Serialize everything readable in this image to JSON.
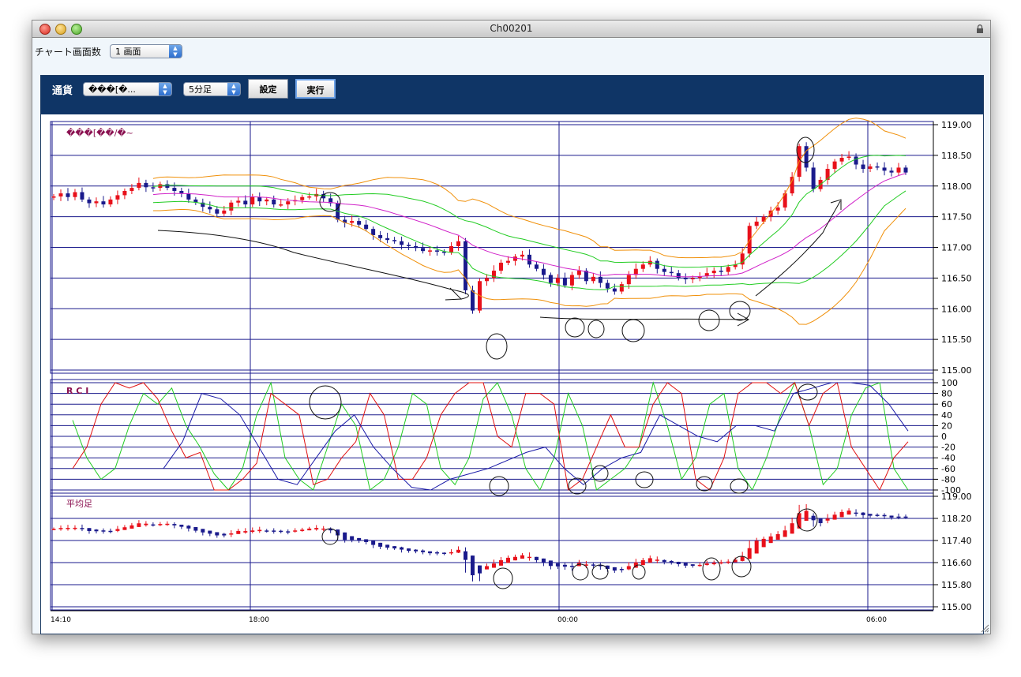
{
  "window": {
    "title": "Ch00201"
  },
  "topbar": {
    "screens_label": "チャート画面数",
    "screens_value": "1 画面"
  },
  "toolbar": {
    "currency_label": "通貨",
    "currency_value": "���[�...",
    "period_value": "5分足",
    "settings_label": "設定",
    "run_label": "実行"
  },
  "colors": {
    "up_candle": "#e8101a",
    "down_candle": "#1a1a8c",
    "grid": "#1a1a8c",
    "toolbar_bg": "#0f3566",
    "bb_outer": "#f0900a",
    "bb_inner": "#22cc22",
    "ma": "#d020c8",
    "rci_short": "#22cc22",
    "rci_mid": "#e01010",
    "rci_long": "#1a1aa8"
  },
  "chart_data": [
    {
      "type": "candlestick",
      "title": "���[��/�~",
      "y_ticks": [
        "119.00",
        "118.50",
        "118.00",
        "117.50",
        "117.00",
        "116.50",
        "116.00",
        "115.50",
        "115.00"
      ],
      "ylim": [
        115.0,
        119.0
      ],
      "overlays": [
        "bollinger-outer",
        "bollinger-inner",
        "moving-average"
      ],
      "close": [
        117.83,
        117.88,
        117.82,
        117.9,
        117.78,
        117.72,
        117.75,
        117.7,
        117.78,
        117.85,
        117.92,
        117.97,
        118.05,
        117.98,
        117.97,
        118.03,
        117.97,
        117.92,
        117.88,
        117.78,
        117.73,
        117.66,
        117.62,
        117.55,
        117.6,
        117.73,
        117.76,
        117.7,
        117.82,
        117.75,
        117.78,
        117.7,
        117.7,
        117.75,
        117.77,
        117.82,
        117.83,
        117.87,
        117.8,
        117.72,
        117.45,
        117.4,
        117.43,
        117.37,
        117.3,
        117.2,
        117.15,
        117.12,
        117.1,
        117.04,
        117.02,
        116.99,
        116.94,
        116.95,
        116.93,
        116.92,
        117.02,
        117.1,
        116.3,
        115.97,
        116.45,
        116.5,
        116.62,
        116.75,
        116.78,
        116.85,
        116.88,
        116.72,
        116.65,
        116.55,
        116.42,
        116.5,
        116.38,
        116.55,
        116.62,
        116.45,
        116.52,
        116.42,
        116.33,
        116.28,
        116.4,
        116.55,
        116.65,
        116.72,
        116.78,
        116.65,
        116.6,
        116.58,
        116.5,
        116.48,
        116.5,
        116.53,
        116.58,
        116.62,
        116.6,
        116.68,
        116.72,
        116.9,
        117.35,
        117.42,
        117.5,
        117.6,
        117.65,
        117.88,
        118.15,
        118.65,
        118.3,
        117.95,
        118.1,
        118.28,
        118.4,
        118.46,
        118.48,
        118.35,
        118.28,
        118.32,
        118.3,
        118.25,
        118.22,
        118.3,
        118.22
      ],
      "annotations": [
        "hand-drawn arrows",
        "hand-drawn circles"
      ]
    },
    {
      "type": "line",
      "title": "R C I",
      "y_ticks": [
        "100",
        "80",
        "60",
        "40",
        "20",
        "0",
        "-20",
        "-40",
        "-60",
        "-80",
        "-100"
      ],
      "ylim": [
        -100,
        100
      ],
      "series": [
        {
          "values": [
            30,
            -40,
            -80,
            -60,
            20,
            80,
            60,
            90,
            20,
            -20,
            -70,
            -100,
            -60,
            40,
            100,
            -40,
            -80,
            -100,
            -20,
            60,
            20,
            -100,
            -80,
            -20,
            80,
            60,
            -60,
            -90,
            -40,
            70,
            100,
            40,
            -60,
            -100,
            -40,
            80,
            20,
            -100,
            -80,
            -60,
            -20,
            100,
            20,
            -80,
            -40,
            60,
            80,
            -60,
            -100,
            -40,
            40,
            100,
            20,
            -90,
            -60,
            40,
            90,
            100,
            -60,
            -100
          ]
        },
        {
          "values": [
            -60,
            -20,
            60,
            100,
            90,
            100,
            70,
            10,
            -40,
            -30,
            -100,
            -100,
            -80,
            -50,
            80,
            60,
            40,
            -90,
            -80,
            -40,
            -10,
            80,
            40,
            -80,
            -80,
            -40,
            40,
            80,
            100,
            100,
            0,
            -20,
            80,
            80,
            60,
            -100,
            -80,
            -20,
            40,
            -20,
            -20,
            60,
            100,
            80,
            -80,
            -100,
            -40,
            80,
            100,
            100,
            80,
            100,
            20,
            80,
            100,
            -20,
            -60,
            -100,
            -40,
            -10
          ]
        },
        {
          "values": [
            -60,
            -10,
            80,
            70,
            40,
            -20,
            -80,
            -90,
            -40,
            10,
            40,
            -20,
            -60,
            -95,
            -100,
            -80,
            -70,
            -60,
            -45,
            -30,
            -20,
            -60,
            -90,
            -60,
            -40,
            -30,
            40,
            20,
            0,
            -10,
            20,
            20,
            10,
            80,
            90,
            100,
            100,
            95,
            60,
            10
          ]
        }
      ]
    },
    {
      "type": "candlestick",
      "title": "平均足",
      "y_ticks": [
        "119.00",
        "118.20",
        "117.40",
        "116.60",
        "115.80",
        "115.00"
      ],
      "ylim": [
        115.0,
        119.0
      ]
    }
  ],
  "x_axis": {
    "labels": [
      "14:10",
      "18:00",
      "00:00",
      "06:00"
    ]
  }
}
